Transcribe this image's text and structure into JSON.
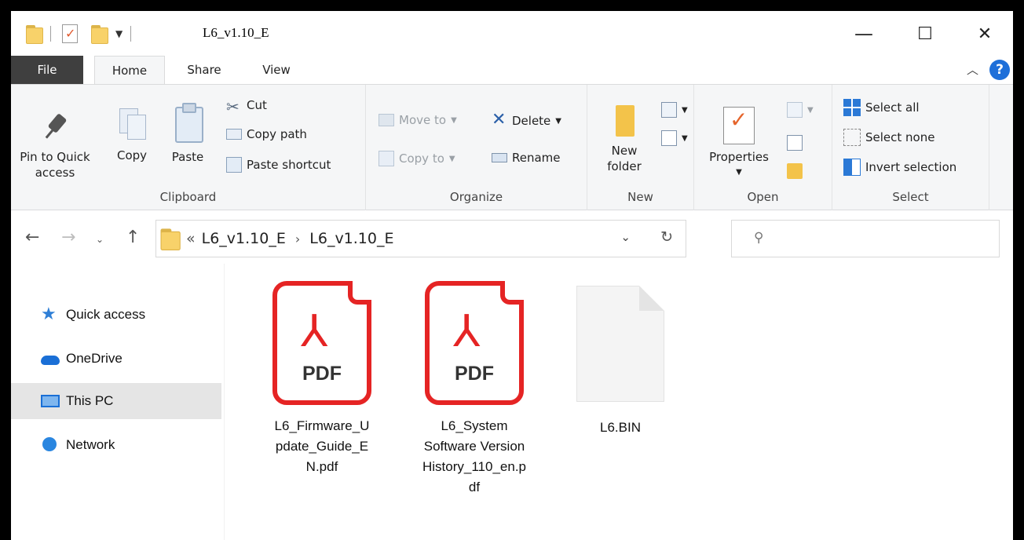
{
  "window": {
    "title": "L6_v1.10_E",
    "minimize": "—",
    "maximize": "☐",
    "close": "✕"
  },
  "tabs": [
    "File",
    "Home",
    "Share",
    "View"
  ],
  "ribbon": {
    "clipboard": {
      "label": "Clipboard",
      "pin": "Pin to Quick access",
      "copy": "Copy",
      "paste": "Paste",
      "cut": "Cut",
      "copy_path": "Copy path",
      "paste_shortcut": "Paste shortcut"
    },
    "organize": {
      "label": "Organize",
      "move_to": "Move to",
      "copy_to": "Copy to",
      "delete": "Delete",
      "rename": "Rename"
    },
    "new": {
      "label": "New",
      "new_folder": "New folder"
    },
    "open": {
      "label": "Open",
      "properties": "Properties"
    },
    "select": {
      "label": "Select",
      "select_all": "Select all",
      "select_none": "Select none",
      "invert": "Invert selection"
    }
  },
  "address": {
    "overflow": "«",
    "crumbs": [
      "L6_v1.10_E",
      "L6_v1.10_E"
    ]
  },
  "sidebar": {
    "items": [
      {
        "label": "Quick access",
        "icon": "star-icon"
      },
      {
        "label": "OneDrive",
        "icon": "cloud-icon"
      },
      {
        "label": "This PC",
        "icon": "computer-icon"
      },
      {
        "label": "Network",
        "icon": "network-icon"
      }
    ],
    "selected": "This PC"
  },
  "files": [
    {
      "name": "L6_Firmware_U\npdate_Guide_E\nN.pdf",
      "type": "pdf"
    },
    {
      "name": "L6_System\nSoftware Version\nHistory_110_en.p\ndf",
      "type": "pdf"
    },
    {
      "name": "L6.BIN",
      "type": "bin"
    }
  ],
  "colors": {
    "pdf_red": "#e52424",
    "accent": "#1a6fd6"
  }
}
